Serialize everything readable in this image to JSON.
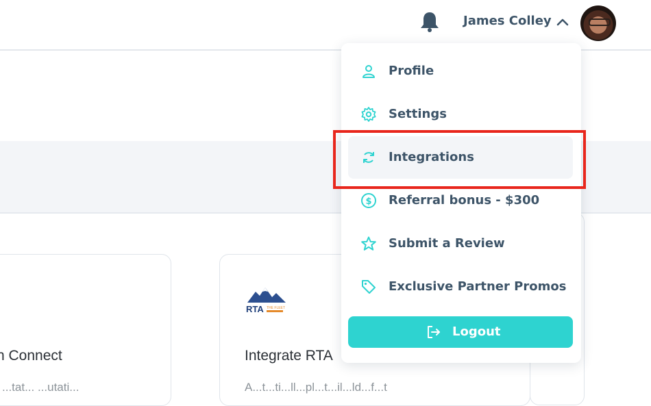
{
  "header": {
    "user_name": "James Colley",
    "icons": [
      "bell-icon",
      "chevron-up-icon"
    ]
  },
  "cards": [
    {
      "title": "n Connect",
      "body": "...tat... ...utati..."
    },
    {
      "title": "Integrate RTA",
      "body": "A...t...ti...ll...pl...t...il...ld...f...t",
      "logo_text": "RTA",
      "logo_tagline": "THE FLEET"
    }
  ],
  "menu": {
    "items": [
      {
        "label": "Profile",
        "icon": "user-icon"
      },
      {
        "label": "Settings",
        "icon": "gear-icon"
      },
      {
        "label": "Integrations",
        "icon": "sync-icon",
        "active": true
      },
      {
        "label": "Referral bonus - $300",
        "icon": "dollar-circle-icon"
      },
      {
        "label": "Submit a Review",
        "icon": "star-icon"
      },
      {
        "label": "Exclusive Partner Promos",
        "icon": "tag-icon"
      }
    ],
    "logout_label": "Logout"
  },
  "colors": {
    "accent": "#2ed3d0",
    "text": "#3d5468",
    "highlight": "#e8261c"
  }
}
